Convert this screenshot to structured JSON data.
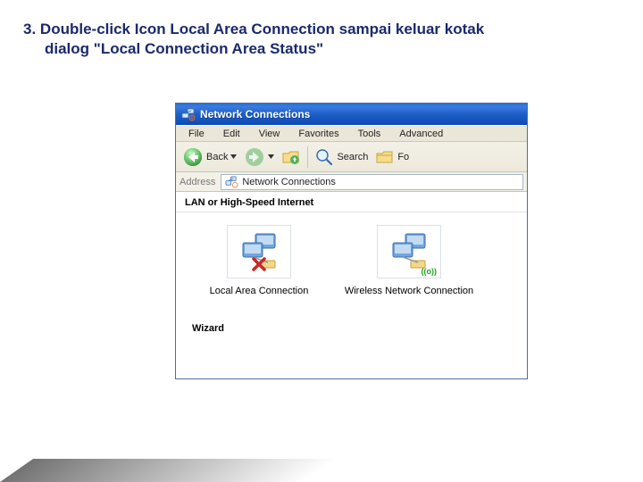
{
  "instruction": {
    "num": "3.",
    "line1": "Double-click Icon Local Area Connection sampai keluar kotak",
    "line2": "dialog \"Local Connection Area  Status\""
  },
  "window": {
    "title": "Network Connections",
    "menu": {
      "file": "File",
      "edit": "Edit",
      "view": "View",
      "favorites": "Favorites",
      "tools": "Tools",
      "advanced": "Advanced"
    },
    "toolbar": {
      "back": "Back",
      "search": "Search",
      "folders_partial": "Fo"
    },
    "addressbar": {
      "label": "Address",
      "value": "Network Connections"
    },
    "section1": "LAN or High-Speed Internet",
    "connections": {
      "lan": "Local Area Connection",
      "wireless": "Wireless Network Connection"
    },
    "wireless_badge": "((o))",
    "section2": "Wizard"
  }
}
